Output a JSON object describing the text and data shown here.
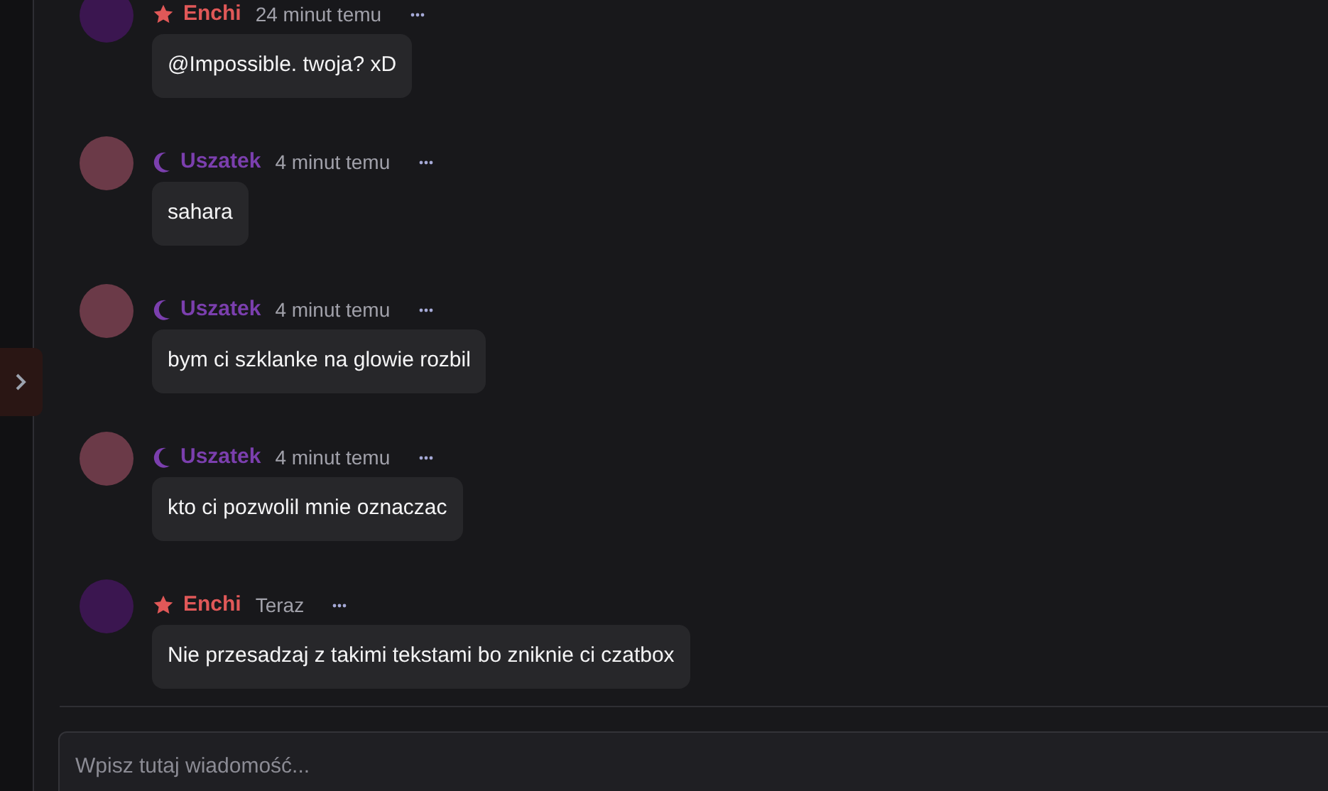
{
  "messages": [
    {
      "author": "Enchi",
      "kind": "star",
      "color": "#e05858",
      "time": "24 minut temu",
      "text": "@Impossible. twoja? xD"
    },
    {
      "author": "Uszatek",
      "kind": "moon",
      "color": "#7b3fae",
      "time": "4 minut temu",
      "text": "sahara"
    },
    {
      "author": "Uszatek",
      "kind": "moon",
      "color": "#7b3fae",
      "time": "4 minut temu",
      "text": "bym ci szklanke na glowie rozbil"
    },
    {
      "author": "Uszatek",
      "kind": "moon",
      "color": "#7b3fae",
      "time": "4 minut temu",
      "text": "kto ci pozwolil mnie oznaczac"
    },
    {
      "author": "Enchi",
      "kind": "star",
      "color": "#e05858",
      "time": "Teraz",
      "text": "Nie przesadzaj z takimi tekstami bo zniknie ci czatbox"
    }
  ],
  "input": {
    "placeholder": "Wpisz tutaj wiadomość..."
  }
}
